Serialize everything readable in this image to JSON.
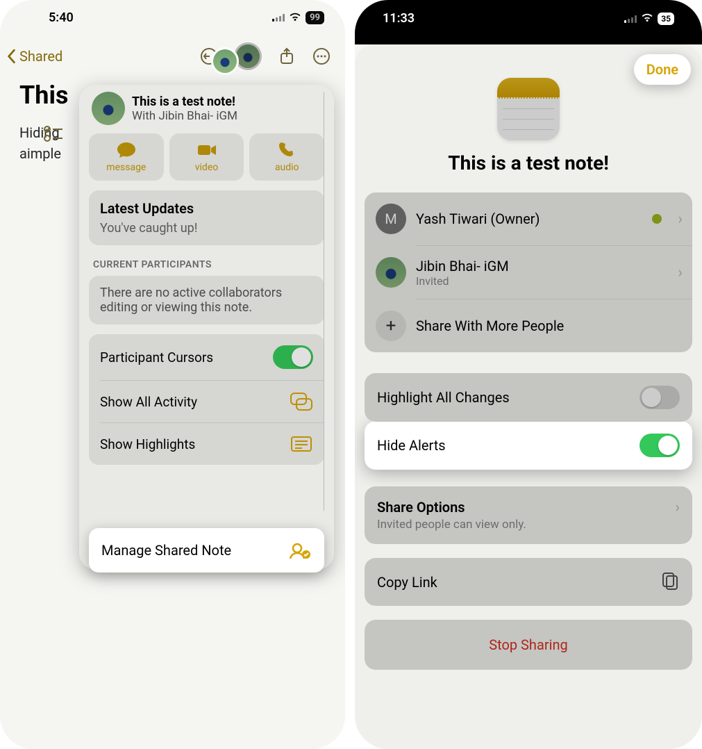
{
  "left": {
    "status": {
      "time": "5:40",
      "battery": "99"
    },
    "nav": {
      "back_label": "Shared"
    },
    "note": {
      "title": "This",
      "line1": "Hiding",
      "line2": "aimple"
    },
    "popover": {
      "header": {
        "title": "This is a test note!",
        "subtitle": "With Jibin Bhai- iGM"
      },
      "actions": {
        "message": "message",
        "video": "video",
        "audio": "audio"
      },
      "updates": {
        "title": "Latest Updates",
        "caught_up": "You've caught up!"
      },
      "participants": {
        "header": "CURRENT PARTICIPANTS",
        "empty": "There are no active collaborators editing or viewing this note."
      },
      "rows": {
        "cursors": "Participant Cursors",
        "activity": "Show All Activity",
        "highlights": "Show Highlights",
        "manage": "Manage Shared Note"
      }
    }
  },
  "right": {
    "status": {
      "time": "11:33",
      "battery": "35"
    },
    "done": "Done",
    "title": "This is a test note!",
    "people": {
      "owner": {
        "initial": "M",
        "name": "Yash Tiwari (Owner)"
      },
      "invitee": {
        "name": "Jibin Bhai- iGM",
        "status": "Invited"
      },
      "share_more": "Share With More People"
    },
    "options": {
      "highlight": "Highlight All Changes",
      "hide_alerts": "Hide Alerts"
    },
    "share_options": {
      "title": "Share Options",
      "subtitle": "Invited people can view only."
    },
    "copy_link": "Copy Link",
    "stop_sharing": "Stop Sharing"
  }
}
